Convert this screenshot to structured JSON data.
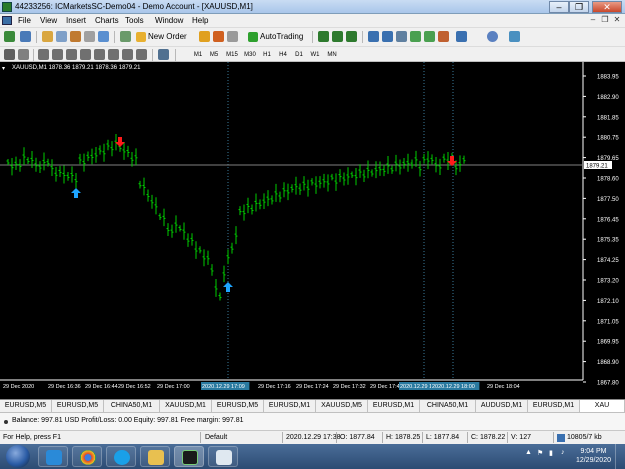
{
  "window": {
    "title": "44233256: ICMarketsSC-Demo04 - Demo Account - [XAUUSD,M1]",
    "minimize": "–",
    "restore": "❐",
    "close": "✕"
  },
  "menu": {
    "items": [
      "File",
      "View",
      "Insert",
      "Charts",
      "Tools",
      "Window",
      "Help"
    ],
    "mdi_min": "–",
    "mdi_restore": "❐",
    "mdi_close": "✕"
  },
  "toolbar": {
    "new_order": "New Order",
    "autotrading": "AutoTrading",
    "timeframes": [
      "M1",
      "M5",
      "M15",
      "M30",
      "H1",
      "H4",
      "D1",
      "W1",
      "MN"
    ]
  },
  "chart": {
    "header": "XAUUSD,M1  1878.36 1879.21 1878.36 1879.21",
    "price_labels": [
      "1883.95",
      "1882.90",
      "1881.85",
      "1880.75",
      "1879.65",
      "1878.60",
      "1877.50",
      "1876.45",
      "1875.35",
      "1874.25",
      "1873.20",
      "1872.10",
      "1871.05",
      "1869.95",
      "1868.90",
      "1867.80"
    ],
    "current_price": "1879.21",
    "time_labels": [
      "29 Dec 2020",
      "29 Dec 16:36",
      "29 Dec 16:44",
      "29 Dec 16:52",
      "29 Dec 17:00",
      "2020.12.29 17:09",
      "29 Dec 17:16",
      "29 Dec 17:24",
      "29 Dec 17:32",
      "29 Dec 17:40",
      "2020.12.29 17:44",
      "2020.12.29 18:00",
      "29 Dec 18:04"
    ],
    "colors": {
      "background": "#000000",
      "bars": "#00cc00",
      "grid_lines": "#3a7a9a",
      "buy_arrow": "#1ea4ff",
      "sell_arrow": "#ff1a1a",
      "bid_line": "#808080"
    },
    "signals": [
      {
        "type": "buy",
        "icon": "up-arrow-icon"
      },
      {
        "type": "sell",
        "icon": "down-arrow-icon"
      },
      {
        "type": "buy",
        "icon": "up-arrow-icon"
      },
      {
        "type": "sell",
        "icon": "down-arrow-icon"
      }
    ]
  },
  "tabs": [
    "EURUSD,M5",
    "EURUSD,M5",
    "CHINA50,M1",
    "XAUUSD,M1",
    "EURUSD,M5",
    "EURUSD,M1",
    "XAUUSD,M5",
    "EURUSD,M1",
    "CHINA50,M1",
    "AUDUSD,M1",
    "EURUSD,M1",
    "XAU"
  ],
  "active_tab": 11,
  "strip": {
    "text": "Balance: 997.81 USD  Profit/Loss: 0.00  Equity: 997.81  Free margin: 997.81"
  },
  "status": {
    "help": "For Help, press F1",
    "profile": "Default",
    "time": "2020.12.29 17:38",
    "open": "O: 1877.84",
    "high": "H: 1878.25",
    "low": "L: 1877.84",
    "close": "C: 1878.22",
    "volume": "V: 127",
    "traffic": "10805/7 kb"
  },
  "taskbar": {
    "time": "9:04 PM",
    "date": "12/29/2020",
    "apps": [
      "ie-icon",
      "chrome-icon",
      "skype-icon",
      "folder-icon",
      "metatrader-icon",
      "notepad-icon"
    ]
  }
}
